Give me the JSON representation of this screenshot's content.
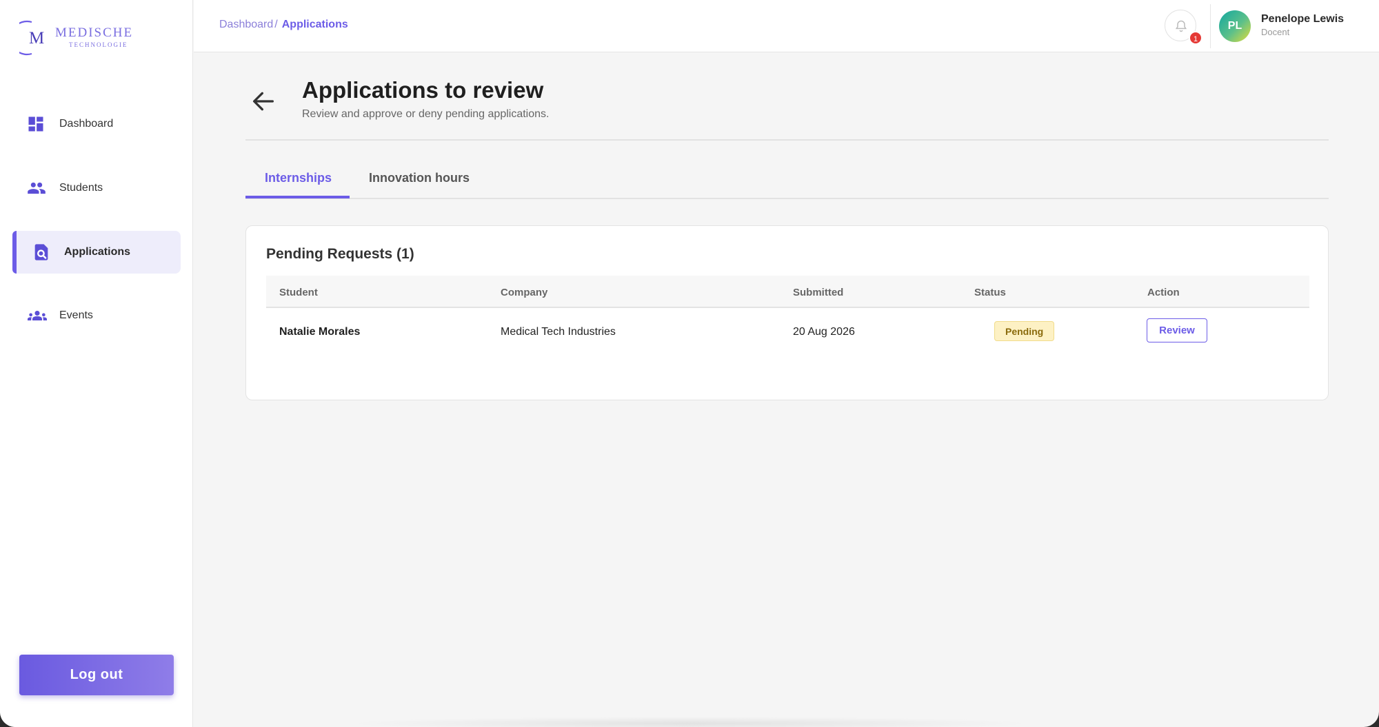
{
  "brand": {
    "logo_letter": "M",
    "logo_line1": "MEDISCHE",
    "logo_line2": "TECHNOLOGIE",
    "accent_color": "#6c5ce7"
  },
  "sidebar": {
    "items": [
      {
        "label": "Dashboard",
        "icon": "dashboard-icon",
        "active": false
      },
      {
        "label": "Students",
        "icon": "people-icon",
        "active": false
      },
      {
        "label": "Applications",
        "icon": "document-search-icon",
        "active": true
      },
      {
        "label": "Events",
        "icon": "group-icon",
        "active": false
      }
    ],
    "logout_label": "Log out"
  },
  "topbar": {
    "breadcrumb": {
      "parent": "Dashboard",
      "separator": "/",
      "current": "Applications"
    },
    "notifications": {
      "icon": "bell-icon",
      "count": "1"
    },
    "user": {
      "initials": "PL",
      "name": "Penelope Lewis",
      "role": "Docent"
    }
  },
  "page": {
    "back_icon": "arrow-left-icon",
    "title": "Applications to review",
    "subtitle": "Review and approve or deny pending applications.",
    "tabs": [
      {
        "label": "Internships",
        "active": true
      },
      {
        "label": "Innovation hours",
        "active": false
      }
    ]
  },
  "table": {
    "title": "Pending Requests (1)",
    "columns": [
      "Student",
      "Company",
      "Submitted",
      "Status",
      "Action"
    ],
    "rows": [
      {
        "student": "Natalie Morales",
        "company": "Medical Tech Industries",
        "submitted": "20 Aug 2026",
        "status": "Pending",
        "action": "Review"
      }
    ]
  }
}
